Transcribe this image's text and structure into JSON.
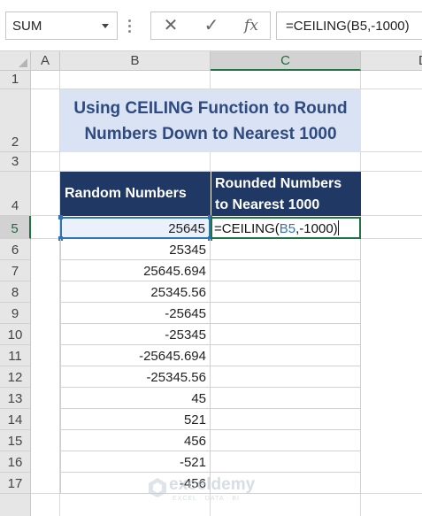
{
  "formula_bar": {
    "name_box": "SUM",
    "cancel_symbol": "✕",
    "enter_symbol": "✓",
    "fx_symbol": "fx",
    "formula": "=CEILING(B5,-1000)"
  },
  "columns": [
    "A",
    "B",
    "C",
    "D"
  ],
  "rows": [
    "1",
    "2",
    "3",
    "4",
    "5",
    "6",
    "7",
    "8",
    "9",
    "10",
    "11",
    "12",
    "13",
    "14",
    "15",
    "16",
    "17"
  ],
  "title": {
    "line1": "Using CEILING Function to Round",
    "line2": "Numbers Down to Nearest 1000"
  },
  "table": {
    "header_b": "Random Numbers",
    "header_c_line1": "Rounded Numbers",
    "header_c_line2": "to Nearest 1000",
    "values": [
      "25645",
      "25345",
      "25645.694",
      "25345.56",
      "-25645",
      "-25345",
      "-25645.694",
      "-25345.56",
      "45",
      "521",
      "456",
      "-521",
      "-456"
    ]
  },
  "active_cell": {
    "address": "C5",
    "edit_prefix": "=CEILING(",
    "edit_ref": "B5",
    "edit_suffix": ",-1000)"
  },
  "watermark": {
    "name": "exceldemy",
    "tagline": "EXCEL · DATA · BI"
  },
  "colors": {
    "title_fill": "#dae3f3",
    "header_fill": "#203864",
    "active_border": "#217346",
    "reference_color": "#2e75b6"
  }
}
